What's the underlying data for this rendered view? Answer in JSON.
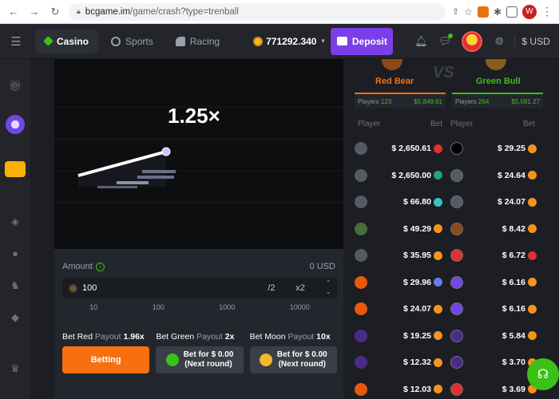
{
  "browser": {
    "url_host": "bcgame.im",
    "url_path": "/game/crash?type=trenball",
    "profile_initial": "W"
  },
  "header": {
    "tabs": [
      {
        "label": "Casino",
        "icon": "casino-icon"
      },
      {
        "label": "Sports",
        "icon": "sports-icon"
      },
      {
        "label": "Racing",
        "icon": "racing-icon"
      }
    ],
    "balance": "771292.340",
    "deposit_label": "Deposit",
    "currency": "$ USD"
  },
  "game": {
    "multiplier": "1.25×"
  },
  "bet_panel": {
    "amount_label": "Amount",
    "amount_value": "0 USD",
    "input_value": "100",
    "half_label": "/2",
    "double_label": "x2",
    "presets": [
      "10",
      "100",
      "1000",
      "10000"
    ],
    "columns": [
      {
        "name": "Bet Red",
        "payout_label": "Payout",
        "payout": "1.96x",
        "button": "Betting"
      },
      {
        "name": "Bet Green",
        "payout_label": "Payout",
        "payout": "2x",
        "button_line1": "Bet for $ 0.00",
        "button_line2": "(Next round)"
      },
      {
        "name": "Bet Moon",
        "payout_label": "Payout",
        "payout": "10x",
        "button_line1": "Bet for $ 0.00",
        "button_line2": "(Next round)"
      }
    ]
  },
  "trenball": {
    "vs_label": "VS",
    "red": {
      "name": "Red Bear",
      "players_label": "Players",
      "players": "123",
      "total": "$5,849.61"
    },
    "green": {
      "name": "Green Bull",
      "players_label": "Players",
      "players": "264",
      "total": "$5,081.27"
    },
    "col_player": "Player",
    "col_bet": "Bet",
    "red_bets": [
      "$ 2,650.61",
      "$ 2,650.00",
      "$ 66.80",
      "$ 49.29",
      "$ 35.95",
      "$ 29.96",
      "$ 24.07",
      "$ 19.25",
      "$ 12.32",
      "$ 12.03"
    ],
    "green_bets": [
      "$ 29.25",
      "$ 24.64",
      "$ 24.07",
      "$ 8.42",
      "$ 6.72",
      "$ 6.16",
      "$ 6.16",
      "$ 5.84",
      "$ 3.70",
      "$ 3.69"
    ]
  },
  "colors": {
    "accent": "#7c3ee8",
    "green": "#3bc117",
    "red_team": "#f86f10",
    "green_team": "#3bc117"
  }
}
